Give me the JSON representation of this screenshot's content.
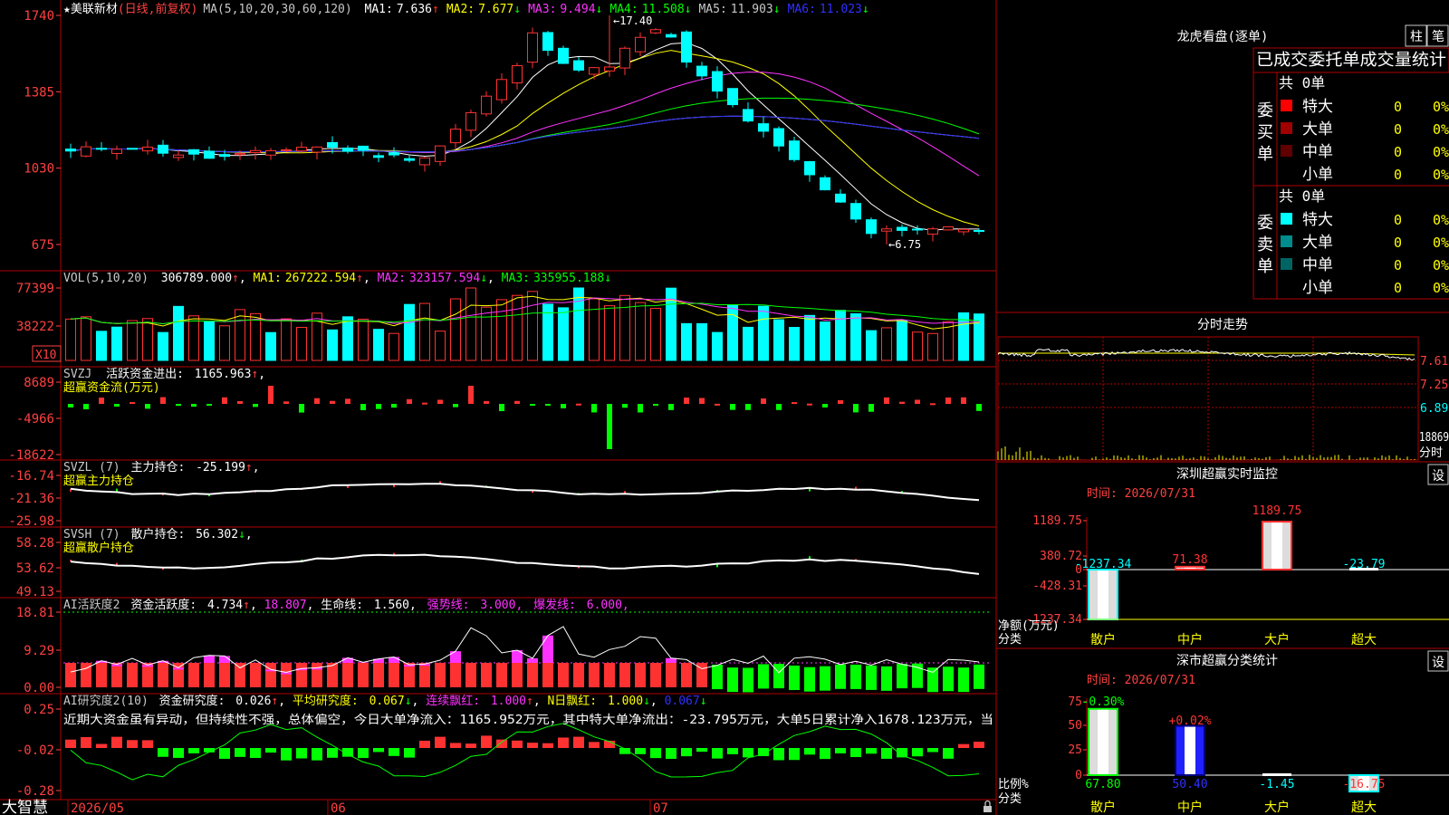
{
  "colors": {
    "up": "#ff3232",
    "down": "#00ffff",
    "vol_down": "#00ffff",
    "green": "#00ff00",
    "magenta": "#ff33ff",
    "yellow": "#ffff00",
    "blue": "#3030ff",
    "grey": "#c0c0c0",
    "axis_red": "#ff4040",
    "frame": "#b00000"
  },
  "main": {
    "title_star": "★",
    "stock_name": "美联新材",
    "period": "(日线,前复权)",
    "ma_params": "MA(5,10,20,30,60,120)",
    "ma_values": [
      {
        "label": "MA1:",
        "value": "7.636",
        "arrow": "↑",
        "color": "#ffffff"
      },
      {
        "label": "MA2:",
        "value": "7.677",
        "arrow": "↓",
        "color": "#ffff00"
      },
      {
        "label": "MA3:",
        "value": "9.494",
        "arrow": "↓",
        "color": "#ff33ff"
      },
      {
        "label": "MA4:",
        "value": "11.508",
        "arrow": "↓",
        "color": "#00ff00"
      },
      {
        "label": "MA5:",
        "value": "11.903",
        "arrow": "↓",
        "color": "#c8c8c8"
      },
      {
        "label": "MA6:",
        "value": "11.023",
        "arrow": "↓",
        "color": "#3030ff"
      }
    ],
    "y_ticks": [
      "1740",
      "1385",
      "1030",
      "675"
    ],
    "high_label": "17.40",
    "low_label": "6.75",
    "high_arrow": "←",
    "low_arrow": "←",
    "high_candle_index": 35,
    "low_candle_index": 53
  },
  "vol": {
    "title": "VOL(5,10,20)",
    "value": "306789.000",
    "ma1_label": "MA1:",
    "ma1": "267222.594",
    "ma2_label": "MA2:",
    "ma2": "323157.594",
    "ma3_label": "MA3:",
    "ma3": "335955.188",
    "arrows": [
      "↑",
      "↑",
      "↓",
      "↓"
    ],
    "y_ticks": [
      "77399",
      "38222"
    ],
    "unit": "X10"
  },
  "svzj": {
    "title": "SVZJ",
    "series_label": "活跃资金进出:",
    "value": "1165.963",
    "arrow": "↑",
    "subtitle": "超赢资金流(万元)",
    "y_ticks": [
      "8689",
      "-4966",
      "-18622"
    ]
  },
  "svzl": {
    "title": "SVZL (7)",
    "series_label": "主力持仓:",
    "value": "-25.199",
    "arrow": "↑",
    "subtitle": "超赢主力持仓",
    "y_ticks": [
      "-16.74",
      "-21.36",
      "-25.98"
    ]
  },
  "svsh": {
    "title": "SVSH (7)",
    "series_label": "散户持仓:",
    "value": "56.302",
    "arrow": "↓",
    "subtitle": "超赢散户持仓",
    "y_ticks": [
      "58.28",
      "53.62",
      "49.13"
    ]
  },
  "ai_active": {
    "title": "AI活跃度2",
    "label1": "资金活跃度:",
    "value1": "4.734",
    "arrow1": "↑",
    "value2": "18.807",
    "label3": "生命线:",
    "value3": "1.560",
    "label4": "强势线:",
    "value4": "3.000",
    "label5": "爆发线:",
    "value5": "6.000",
    "y_ticks": [
      "18.81",
      "9.29",
      "0.00"
    ]
  },
  "ai_research": {
    "title": "AI研究度2(10)",
    "label1": "资金研究度:",
    "value1": "0.026",
    "arrow1": "↑",
    "label2": "平均研究度:",
    "value2": "0.067",
    "arrow2": "↓",
    "label3": "连续飘红:",
    "value3": "1.000",
    "arrow3": "↑",
    "label4": "N日飘红:",
    "value4": "1.000",
    "arrow4": "↓",
    "value5": "0.067",
    "arrow5": "↓",
    "comment": "近期大资金虽有异动，但持续性不强，总体偏空，今日大单净流入：1165.952万元，其中特大单净流出：-23.795万元，大单5日累计净入1678.123万元，当",
    "y_ticks": [
      "0.25",
      "-0.02",
      "-0.28"
    ]
  },
  "bottom": {
    "brand": "大智慧",
    "dates": [
      "2026/05",
      "06",
      "07"
    ],
    "lock_icon": "lock-icon"
  },
  "longhu": {
    "title": "龙虎看盘(逐单)",
    "btn1": "柱",
    "btn2": "笔",
    "header": "已成交委托单成交量统计",
    "buy_side": "委买单",
    "sell_side": "委卖单",
    "buy_total": "共 0单",
    "sell_total": "共 0单",
    "buy_rows": [
      {
        "name": "特大",
        "count": "0",
        "pct": "0%",
        "color": "#ff0000"
      },
      {
        "name": "大单",
        "count": "0",
        "pct": "0%",
        "color": "#a00000"
      },
      {
        "name": "中单",
        "count": "0",
        "pct": "0%",
        "color": "#600000"
      },
      {
        "name": "小单",
        "count": "0",
        "pct": "0%",
        "color": ""
      }
    ],
    "sell_rows": [
      {
        "name": "特大",
        "count": "0",
        "pct": "0%",
        "color": "#00ffff"
      },
      {
        "name": "大单",
        "count": "0",
        "pct": "0%",
        "color": "#008c8c"
      },
      {
        "name": "中单",
        "count": "0",
        "pct": "0%",
        "color": "#006464"
      },
      {
        "name": "小单",
        "count": "0",
        "pct": "0%",
        "color": ""
      }
    ]
  },
  "fenshi": {
    "title": "分时走势",
    "y_ticks": [
      "7.61",
      "7.25",
      "6.89"
    ],
    "vol_tick": "18869",
    "vol_unit": "分时"
  },
  "sz_monitor": {
    "title": "深圳超赢实时监控",
    "btn": "设",
    "time": "时间: 2026/07/31",
    "y_ticks": [
      "1189.75",
      "380.72",
      "0",
      "-428.31",
      "-1237.34"
    ],
    "ylabel": "净额(万元)",
    "xlabel": "分类",
    "chart_data": {
      "type": "bar",
      "categories": [
        "散户",
        "中户",
        "大户",
        "超大"
      ],
      "values": [
        -1237.34,
        71.38,
        1189.75,
        -23.79
      ],
      "value_labels": [
        "-1237.34",
        "71.38",
        "1189.75",
        "-23.79"
      ],
      "ylim": [
        -1237.34,
        1189.75
      ]
    }
  },
  "sz_class": {
    "title": "深市超赢分类统计",
    "btn": "设",
    "time": "时间: 2026/07/31",
    "y_ticks": [
      "75",
      "50",
      "25",
      "0"
    ],
    "ylabel": "比例%",
    "xlabel": "分类",
    "chart_data": {
      "type": "bar",
      "categories": [
        "散户",
        "中户",
        "大户",
        "超大"
      ],
      "values": [
        67.8,
        50.4,
        -1.45,
        -16.75
      ],
      "value_labels": [
        "67.80",
        "50.40",
        "-1.45",
        "-16.75"
      ],
      "change_labels": [
        "-0.30%",
        "+0.02%",
        "",
        ""
      ],
      "ylim": [
        0,
        75
      ]
    }
  }
}
